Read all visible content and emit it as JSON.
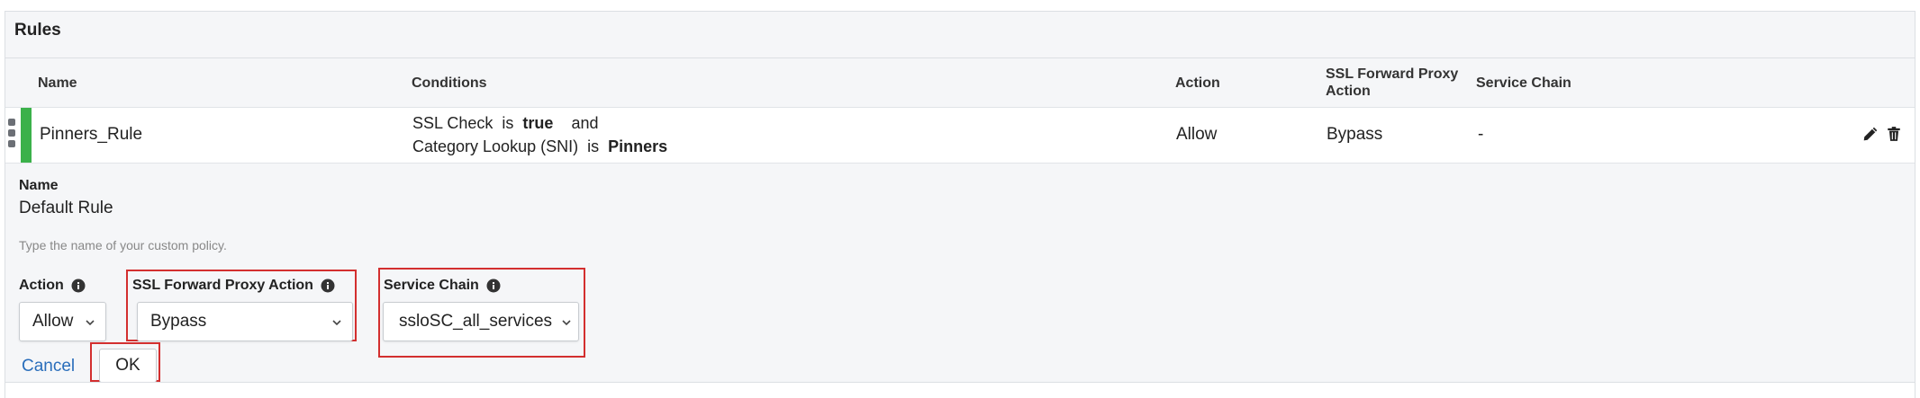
{
  "panel": {
    "title": "Rules"
  },
  "columns": {
    "name": "Name",
    "conditions": "Conditions",
    "action": "Action",
    "ssl_forward_proxy_action": "SSL Forward Proxy Action",
    "service_chain": "Service Chain"
  },
  "rule": {
    "name": "Pinners_Rule",
    "status_color": "#3bb14a",
    "conditions": {
      "line1": {
        "subject": "SSL Check",
        "op": "is",
        "value": "true",
        "conj": "and"
      },
      "line2": {
        "subject": "Category Lookup (SNI)",
        "op": "is",
        "value": "Pinners"
      }
    },
    "action": "Allow",
    "ssl_forward_proxy_action": "Bypass",
    "service_chain": "-",
    "icons": [
      "pencil-icon",
      "trash-icon"
    ]
  },
  "editor": {
    "name_label": "Name",
    "name_value": "Default Rule",
    "name_help": "Type the name of your custom policy.",
    "action_label": "Action",
    "action_value": "Allow",
    "ssl_label": "SSL Forward Proxy Action",
    "ssl_value": "Bypass",
    "service_chain_label": "Service Chain",
    "service_chain_value": "ssloSC_all_services",
    "cancel_label": "Cancel",
    "ok_label": "OK",
    "highlight_color": "#d32f2f"
  }
}
